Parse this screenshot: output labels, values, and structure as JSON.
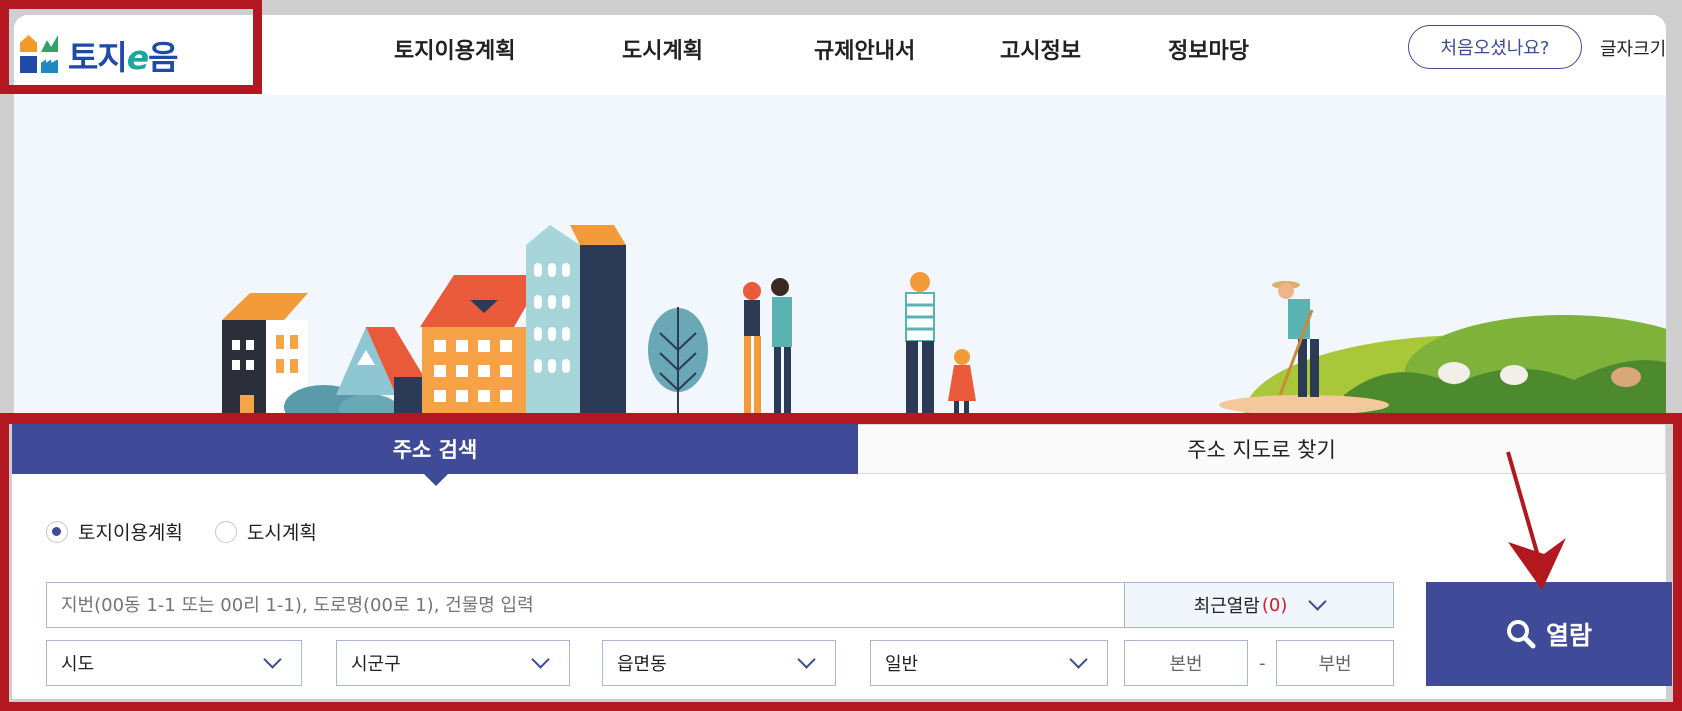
{
  "header": {
    "logo_text_a": "토지",
    "logo_text_e": "e",
    "logo_text_b": "음",
    "nav": [
      "토지이용계획",
      "도시계획",
      "규제안내서",
      "고시정보",
      "정보마당"
    ],
    "first_visit": "처음오셨나요?",
    "font_size": "글자크기"
  },
  "search": {
    "tabs": [
      "주소 검색",
      "주소 지도로 찾기"
    ],
    "radios": [
      "토지이용계획",
      "도시계획"
    ],
    "selected_radio": "토지이용계획",
    "placeholder": "지번(00동 1-1 또는 00리 1-1), 도로명(00로 1), 건물명 입력",
    "recent_label": "최근열람",
    "recent_count": "(0)",
    "selects": [
      "시도",
      "시군구",
      "읍면동",
      "일반"
    ],
    "main_no": "본번",
    "dash": "-",
    "sub_no": "부번",
    "view_button": "열람"
  },
  "colors": {
    "primary": "#3f4b98",
    "annotation": "#b3171f",
    "count": "#d1202a",
    "hero_bg": "#f2f7fe"
  }
}
